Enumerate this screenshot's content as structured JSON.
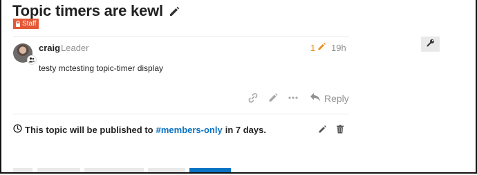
{
  "topic": {
    "title": "Topic timers are kewl",
    "badge_label": "Staff",
    "edit_title_icon": "pencil-icon"
  },
  "post": {
    "username": "craig",
    "user_title": "Leader",
    "edit_count": "1",
    "time": "19h",
    "body": "testy mctesting topic-timer display",
    "reply_label": "Reply",
    "avatar_flair_icon": "users-icon",
    "actions": [
      "link-icon",
      "pencil-icon",
      "ellipsis-icon",
      "reply-icon"
    ]
  },
  "admin": {
    "icon": "wrench-icon"
  },
  "timer": {
    "prefix": "This topic will be published to",
    "category": "#members-only",
    "suffix": "in 7 days.",
    "icon": "clock-icon"
  },
  "colors": {
    "accent": "#0a72c3",
    "staff_badge": "#e45735",
    "edit_count": "#e88f1f",
    "muted": "#919191"
  }
}
